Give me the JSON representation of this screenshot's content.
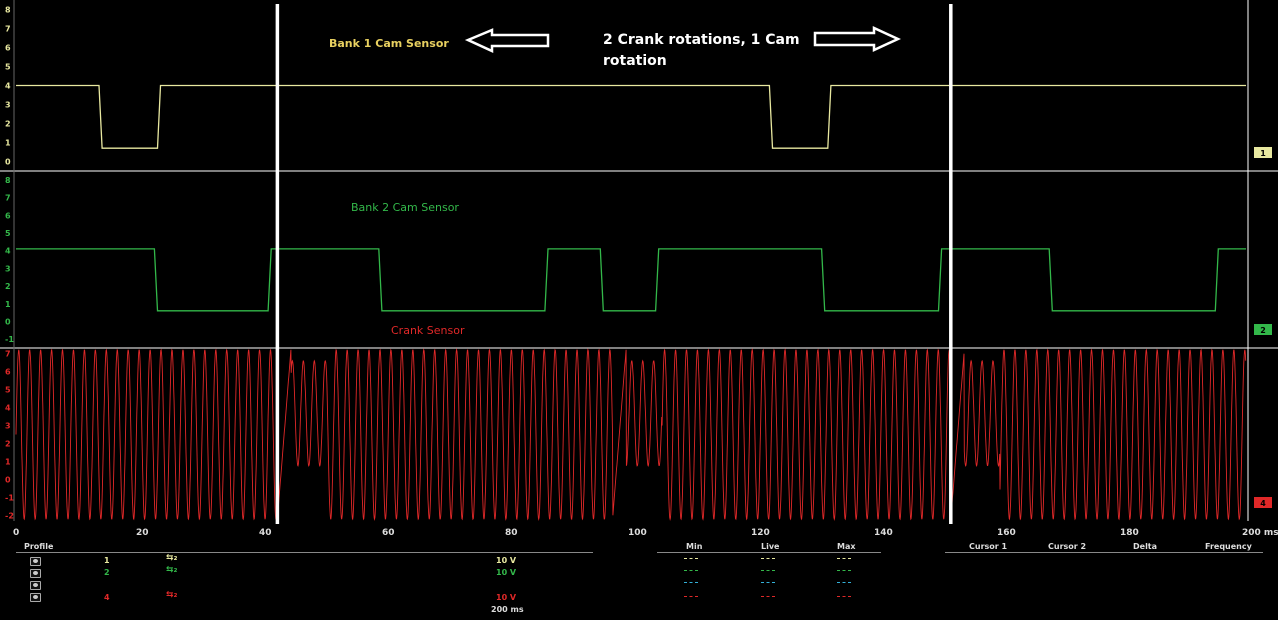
{
  "colors": {
    "ch1": "#e8e8a0",
    "ch2": "#33b84a",
    "ch4": "#e02828",
    "grid": "#ffffff",
    "background": "#000000",
    "cursor": "#ffffff"
  },
  "annotations": {
    "bank1_label": "Bank 1 Cam Sensor",
    "bank2_label": "Bank 2 Cam Sensor",
    "crank_label": "Crank Sensor",
    "rotation_text_line1": "2 Crank rotations, 1 Cam",
    "rotation_text_line2": "rotation",
    "left-arrow-icon": "left-arrow-icon",
    "right-arrow-icon": "right-arrow-icon"
  },
  "chart_data": [
    {
      "type": "line",
      "channel_badge": "1",
      "color": "#e8e8a0",
      "y_ticks": [
        "8",
        "7",
        "6",
        "5",
        "4",
        "3",
        "2",
        "1",
        "0"
      ],
      "ylim": [
        -0.5,
        8.5
      ],
      "xlim": [
        0,
        200
      ],
      "series": [
        {
          "x": [
            0,
            13.5,
            14,
            23,
            23.5,
            122.5,
            123,
            132,
            132.5,
            200
          ],
          "values": [
            4.0,
            4.0,
            0.7,
            0.7,
            4.0,
            4.0,
            0.7,
            0.7,
            4.0,
            4.0
          ]
        }
      ]
    },
    {
      "type": "line",
      "channel_badge": "2",
      "color": "#33b84a",
      "y_ticks": [
        "8",
        "7",
        "6",
        "5",
        "4",
        "3",
        "2",
        "1",
        "0",
        "-1"
      ],
      "ylim": [
        -1.5,
        8.5
      ],
      "xlim": [
        0,
        200
      ],
      "series": [
        {
          "x": [
            0,
            22.5,
            23,
            41,
            41.5,
            59,
            59.5,
            86,
            86.5,
            95,
            95.5,
            104,
            104.5,
            131,
            131.5,
            150,
            150.5,
            168,
            168.5,
            195,
            195.5,
            200
          ],
          "values": [
            4.1,
            4.1,
            0.6,
            0.6,
            4.1,
            4.1,
            0.6,
            0.6,
            4.1,
            4.1,
            0.6,
            0.6,
            4.1,
            4.1,
            0.6,
            0.6,
            4.1,
            4.1,
            0.6,
            0.6,
            4.1,
            4.1
          ]
        }
      ]
    },
    {
      "type": "line",
      "channel_badge": "4",
      "color": "#e02828",
      "y_ticks": [
        "7",
        "6",
        "5",
        "4",
        "3",
        "2",
        "1",
        "0",
        "-1",
        "-2"
      ],
      "ylim": [
        -2.3,
        7.3
      ],
      "xlim": [
        0,
        200
      ],
      "signal": "crank_tooth_wheel",
      "oscillation_low": -2.2,
      "oscillation_high": 7.2,
      "oscillation_period_ms": 1.78,
      "missing_tooth_gaps_ms": [
        42.5,
        97,
        152
      ],
      "x_ticks": [
        "0",
        "20",
        "40",
        "60",
        "80",
        "100",
        "120",
        "140",
        "160",
        "180",
        "200 ms"
      ],
      "x_tick_values": [
        0,
        20,
        40,
        60,
        80,
        100,
        120,
        140,
        160,
        180,
        200
      ]
    }
  ],
  "cursors_ms": [
    42.5,
    152
  ],
  "bottom_panel": {
    "profile_header": "Profile",
    "channels": [
      {
        "id": "1",
        "scale": "10 V",
        "color": "#e8e8a0",
        "probe_icon": "probe-icon"
      },
      {
        "id": "2",
        "scale": "10 V",
        "color": "#33b84a",
        "probe_icon": "probe-icon"
      },
      {
        "id": "",
        "scale": "",
        "color": "#33b0d8",
        "probe_icon": ""
      },
      {
        "id": "4",
        "scale": "10 V",
        "color": "#e02828",
        "probe_icon": "probe-icon"
      }
    ],
    "timebase": "200 ms",
    "measure_headers": [
      "Min",
      "Live",
      "Max"
    ],
    "cursor_headers": [
      "Cursor 1",
      "Cursor 2",
      "Delta",
      "Frequency"
    ]
  }
}
